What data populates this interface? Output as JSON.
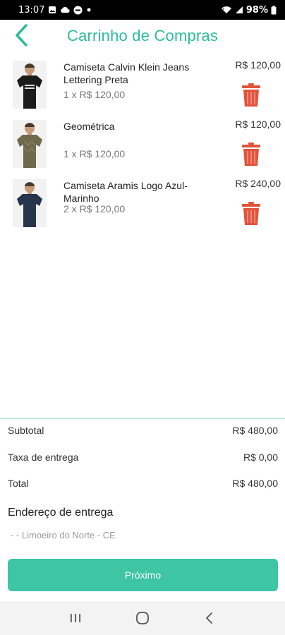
{
  "status_bar": {
    "time": "13:07",
    "battery": "98%",
    "icons": [
      "gallery-icon",
      "cloud-icon",
      "messenger-icon",
      "dot-icon",
      "wifi-icon",
      "signal-icon",
      "battery-icon"
    ]
  },
  "header": {
    "title": "Carrinho de Compras",
    "back_icon": "chevron-left-icon",
    "accent_color": "#2bbd9a"
  },
  "cart": {
    "items": [
      {
        "name": "Camiseta Calvin Klein Jeans Lettering Preta",
        "qty": "1 x R$ 120,00",
        "price": "R$ 120,00",
        "shirt_color": "#1b1b1b"
      },
      {
        "name": "Geométrica",
        "qty": "1 x R$ 120,00",
        "price": "R$ 120,00",
        "shirt_color": "#6f6a4e"
      },
      {
        "name": "Camiseta Aramis Logo Azul-Marinho",
        "qty": "2 x R$ 120,00",
        "price": "R$ 240,00",
        "shirt_color": "#27354c"
      }
    ],
    "trash_color": "#e2533b"
  },
  "summary": {
    "subtotal_label": "Subtotal",
    "subtotal_value": "R$ 480,00",
    "delivery_label": "Taxa de entrega",
    "delivery_value": "R$ 0,00",
    "total_label": "Total",
    "total_value": "R$ 480,00"
  },
  "address": {
    "title": "Endereço de entrega",
    "value": "- - Limoeiro do Norte - CE"
  },
  "next_button": {
    "label": "Próximo",
    "color": "#3ec5a3"
  },
  "nav": {
    "icons": [
      "recent-apps-icon",
      "home-icon",
      "back-icon"
    ]
  }
}
